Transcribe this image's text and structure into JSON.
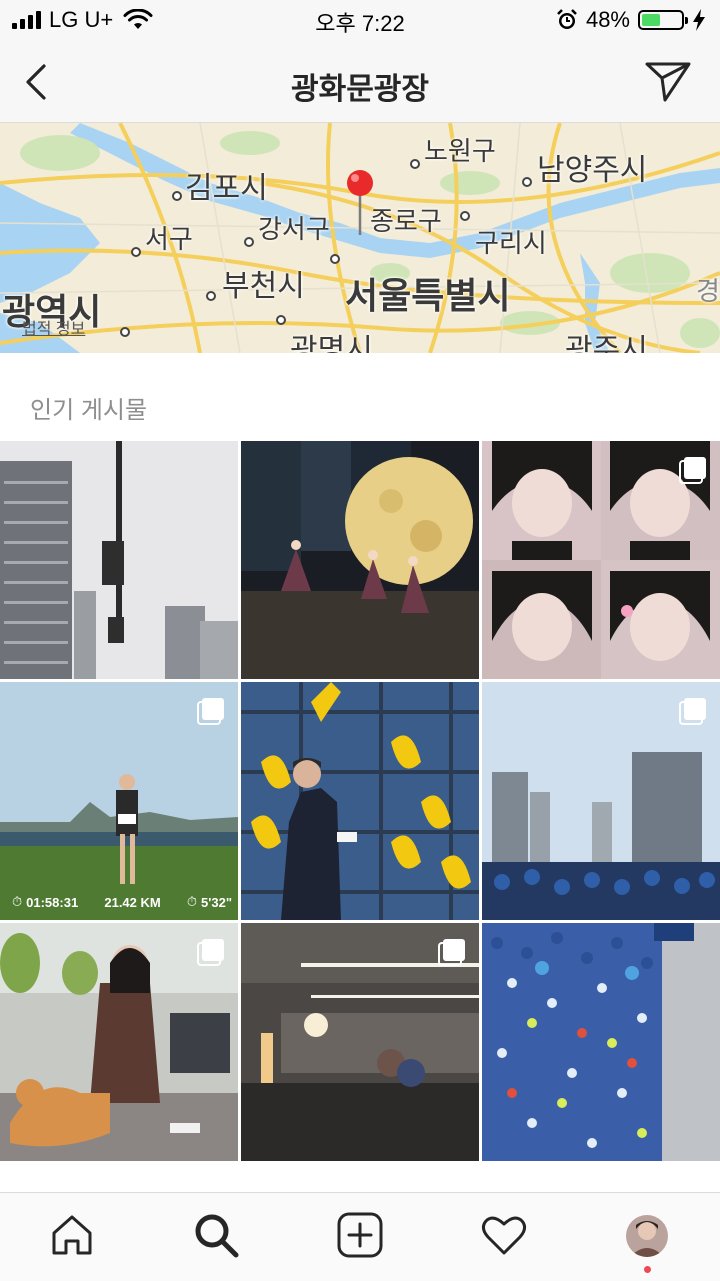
{
  "status_bar": {
    "carrier": "LG U+",
    "time": "오후 7:22",
    "battery_percent": "48%",
    "battery_level": 0.48
  },
  "header": {
    "title": "광화문광장",
    "back_icon": "chevron-left-icon",
    "direct_icon": "paper-plane-icon"
  },
  "map": {
    "labels": {
      "gimpo": "김포시",
      "seogu": "서구",
      "gangseo": "강서구",
      "jongno": "종로구",
      "nowon": "노원구",
      "namyangju": "남양주시",
      "guri": "구리시",
      "bucheon": "부천시",
      "seoul": "서울특별시",
      "incheon": "광역시",
      "gwangmyeong": "광명시",
      "gwangju": "광주시",
      "gyeong": "경"
    },
    "legal": "법적 정보"
  },
  "section": {
    "title": "인기 게시물"
  },
  "posts": {
    "run_time": "01:58:31",
    "run_distance": "21.42 KM",
    "run_pace": "5'32\""
  },
  "tabs": {
    "home": "home-icon",
    "search": "search-icon",
    "add": "add-post-icon",
    "activity": "heart-icon",
    "profile": "profile-avatar"
  },
  "colors": {
    "bar_bg": "#f7f7f7",
    "section_text": "#8e8e8e",
    "notification_dot": "#ed4956",
    "battery_green": "#4cd964"
  }
}
